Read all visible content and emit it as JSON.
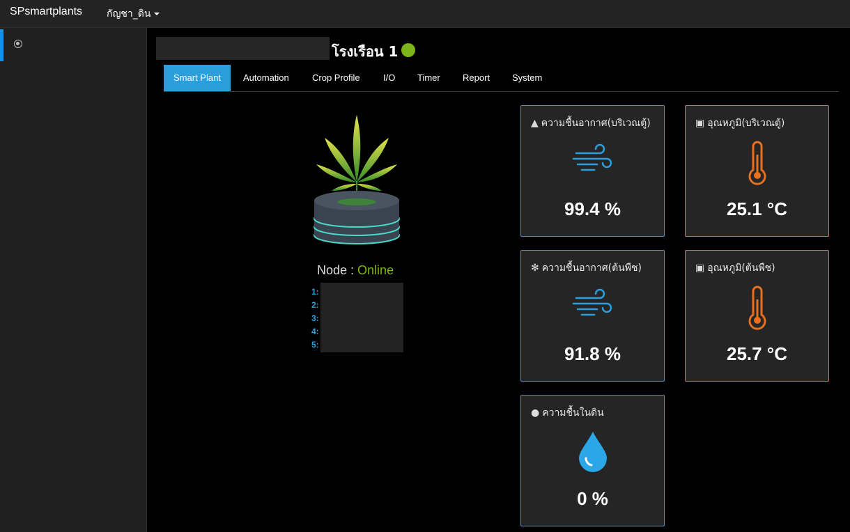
{
  "header": {
    "brand": "SPsmartplants",
    "dropdown_label": "กัญชา_ดิน"
  },
  "page": {
    "title": "โรงเรือน 1",
    "status_color": "#7cb518"
  },
  "tabs": [
    {
      "label": "Smart Plant",
      "active": true
    },
    {
      "label": "Automation"
    },
    {
      "label": "Crop Profile"
    },
    {
      "label": "I/O"
    },
    {
      "label": "Timer"
    },
    {
      "label": "Report"
    },
    {
      "label": "System"
    }
  ],
  "node": {
    "label": "Node : ",
    "status": "Online",
    "list": [
      "1:",
      "2:",
      "3:",
      "4:",
      "5:"
    ]
  },
  "cards": [
    {
      "title": "ความชื้นอากาศ(บริเวณตู้)",
      "icon": "tree-icon",
      "graphic": "wind-icon",
      "value": "99.4 %",
      "accent": "#2b9fdb"
    },
    {
      "title": "อุณหภูมิ(บริเวณตู้)",
      "icon": "scale-icon",
      "graphic": "thermometer-icon",
      "value": "25.1 °C",
      "accent": "#e8701f"
    },
    {
      "title": "ความชื้นอากาศ(ต้นพืช)",
      "icon": "snowflake-icon",
      "graphic": "wind-icon",
      "value": "91.8 %",
      "accent": "#2b9fdb"
    },
    {
      "title": "อุณหภูมิ(ต้นพืช)",
      "icon": "scale-icon",
      "graphic": "thermometer-icon",
      "value": "25.7 °C",
      "accent": "#e8701f"
    },
    {
      "title": "ความชื้นในดิน",
      "icon": "droplet-icon",
      "graphic": "water-drop-icon",
      "value": "0 %",
      "accent": "#2b9fdb"
    }
  ]
}
